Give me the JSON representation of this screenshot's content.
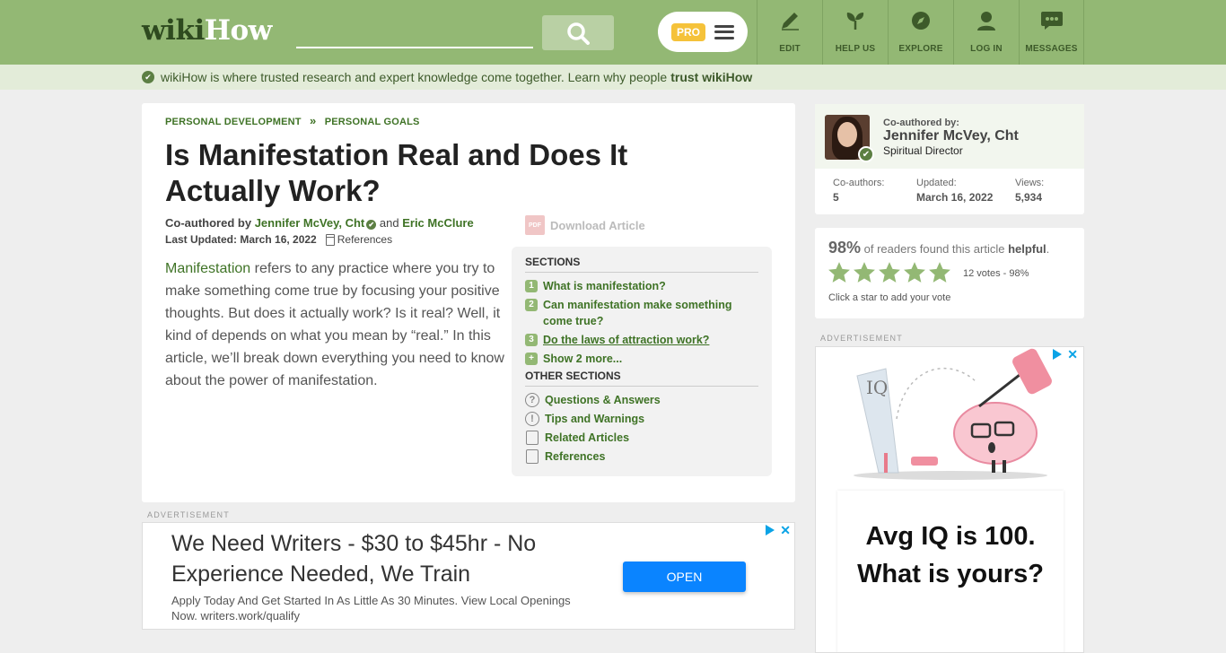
{
  "header": {
    "logo_wiki": "wiki",
    "logo_how": "How",
    "search_placeholder": "",
    "pro_badge": "PRO",
    "nav": [
      {
        "label": "EDIT",
        "icon": "pencil-icon"
      },
      {
        "label": "HELP US",
        "icon": "sprout-icon"
      },
      {
        "label": "EXPLORE",
        "icon": "compass-icon"
      },
      {
        "label": "LOG IN",
        "icon": "user-icon"
      },
      {
        "label": "MESSAGES",
        "icon": "chat-icon"
      }
    ]
  },
  "trust_bar": {
    "text": "wikiHow is where trusted research and expert knowledge come together. Learn why people",
    "link": "trust wikiHow"
  },
  "article": {
    "breadcrumb": [
      "PERSONAL DEVELOPMENT",
      "PERSONAL GOALS"
    ],
    "breadcrumb_sep": "»",
    "title": "Is Manifestation Real and Does It Actually Work?",
    "coauthored_prefix": "Co-authored by",
    "author1": "Jennifer McVey, Cht",
    "and": "and",
    "author2": "Eric McClure",
    "updated_label": "Last Updated: March 16, 2022",
    "references_label": "References",
    "download_label": "Download Article",
    "pdf_text": "PDF",
    "intro_link": "Manifestation",
    "intro_rest": " refers to any practice where you try to make something come true by focusing your positive thoughts. But does it actually work? Is it real? Well, it kind of depends on what you mean by “real.” In this article, we’ll break down everything you need to know about the power of manifestation."
  },
  "toc": {
    "sections_heading": "SECTIONS",
    "sections": [
      {
        "num": "1",
        "label": "What is manifestation?"
      },
      {
        "num": "2",
        "label": "Can manifestation make something come true?"
      },
      {
        "num": "3",
        "label": "Do the laws of attraction work?"
      },
      {
        "num": "+",
        "label": "Show 2 more..."
      }
    ],
    "other_heading": "OTHER SECTIONS",
    "other": [
      {
        "label": "Questions & Answers",
        "glyph": "?"
      },
      {
        "label": "Tips and Warnings",
        "glyph": "!"
      },
      {
        "label": "Related Articles",
        "glyph": ""
      },
      {
        "label": "References",
        "glyph": ""
      }
    ]
  },
  "bottom_ad": {
    "label": "ADVERTISEMENT",
    "headline": "We Need Writers - $30 to $45hr - No Experience Needed, We Train",
    "description": "Apply Today And Get Started In As Little As 30 Minutes. View Local Openings Now. writers.work/qualify",
    "button": "OPEN",
    "close_glyph": "✕"
  },
  "author_card": {
    "label": "Co-authored by:",
    "name": "Jennifer McVey, Cht",
    "role": "Spiritual Director",
    "stats": [
      {
        "label": "Co-authors:",
        "value": "5"
      },
      {
        "label": "Updated:",
        "value": "March 16, 2022"
      },
      {
        "label": "Views:",
        "value": "5,934"
      }
    ]
  },
  "rating": {
    "percent": "98%",
    "text": " of readers found this article ",
    "helpful": "helpful",
    "period": ".",
    "stars": 5,
    "votes": "12 votes - 98%",
    "cta": "Click a star to add your vote"
  },
  "side_ad": {
    "label": "ADVERTISEMENT",
    "art_label": "IQ",
    "text": "Avg IQ is 100. What is yours?",
    "close_glyph": "✕"
  },
  "colors": {
    "header_bg": "#93b874",
    "link_green": "#3f7326",
    "trust_bg": "#e3ecd9",
    "ad_button": "#0a84ff",
    "star": "#93b874"
  }
}
